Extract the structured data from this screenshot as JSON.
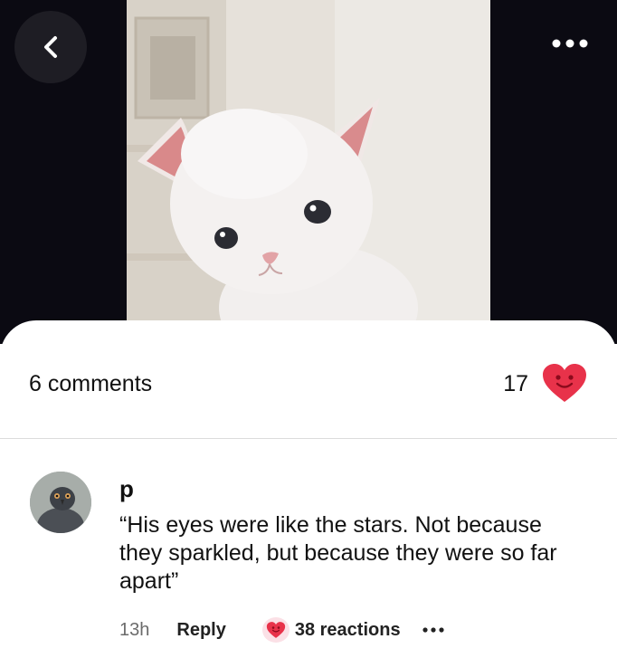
{
  "viewer": {
    "back_icon": "chevron-left-icon",
    "more_icon": "more-horizontal-icon",
    "photo_subject": "kitten-photo"
  },
  "stats": {
    "comments_label": "6 comments",
    "likes_count": "17",
    "like_icon": "heart-face-icon"
  },
  "comment": {
    "author": "p",
    "text": "“His eyes were like the stars. Not because they sparkled, but because they were so far apart”",
    "time": "13h",
    "reply_label": "Reply",
    "reactions_label": "38 reactions",
    "more_icon": "more-horizontal-icon"
  },
  "colors": {
    "viewer_bg": "#0b0a12",
    "heart": "#e8324a",
    "heart_face": "#8b0a1c"
  }
}
